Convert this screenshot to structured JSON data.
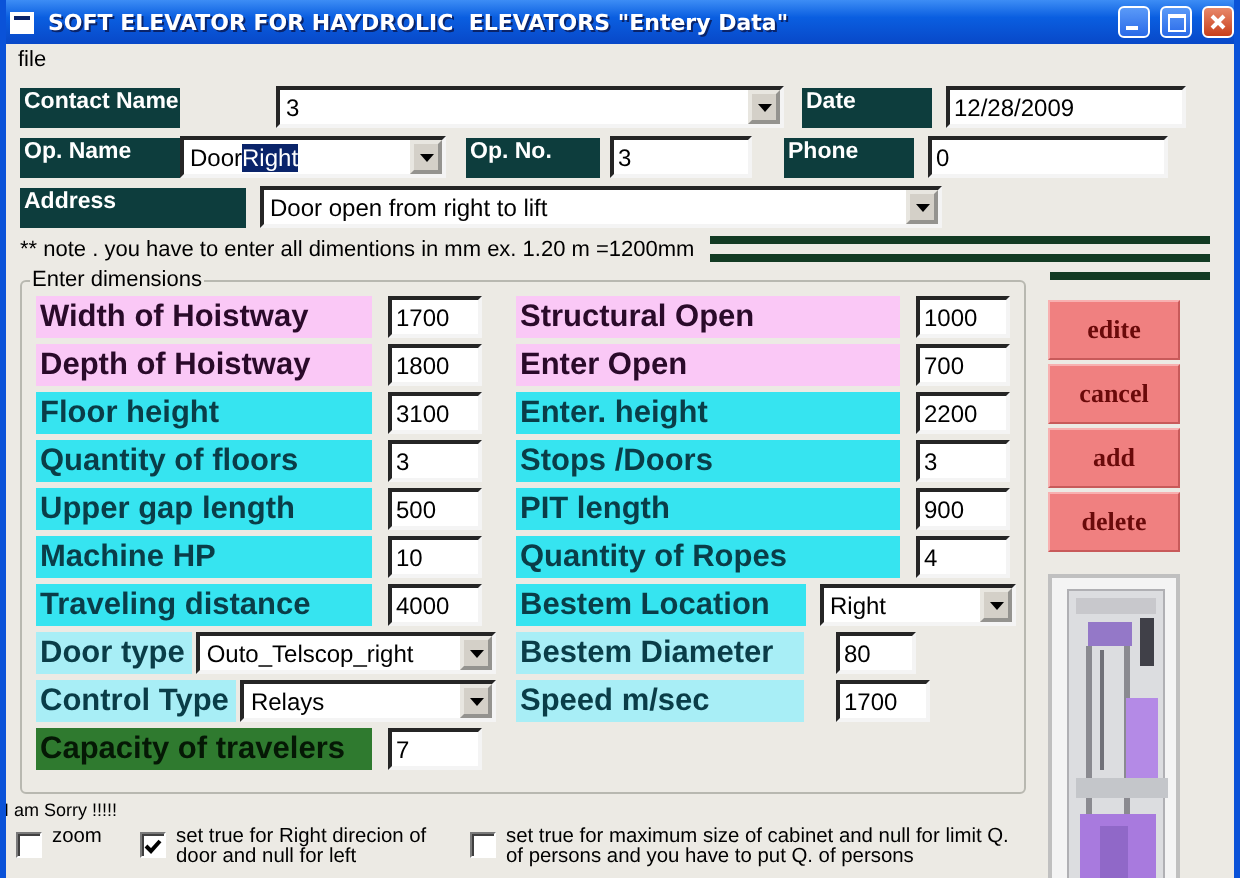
{
  "window": {
    "title": "SOFT ELEVATOR FOR HAYDROLIC  ELEVATORS \"Entery Data\""
  },
  "menu": [
    {
      "label": "file"
    }
  ],
  "header": {
    "contact_name": {
      "label": "Contact Name",
      "value": "3"
    },
    "date": {
      "label": "Date",
      "value": "12/28/2009"
    },
    "op_name": {
      "label": "Op. Name",
      "value": "Door",
      "highlighted": "Right"
    },
    "op_no": {
      "label": "Op. No.",
      "value": "3"
    },
    "phone": {
      "label": "Phone",
      "value": "0"
    },
    "address": {
      "label": "Address",
      "value": "Door open from right to lift"
    }
  },
  "note": "** note . you have to enter all dimentions in mm ex. 1.20 m =1200mm",
  "dimensions": {
    "title": "Enter dimensions",
    "rows": [
      [
        {
          "label": "Width of Hoistway",
          "color": "#fac8f6",
          "kind": "field",
          "value": "1700"
        },
        {
          "label": "Structural Open",
          "color": "#fac8f6",
          "kind": "field",
          "value": "1000"
        }
      ],
      [
        {
          "label": "Depth of Hoistway",
          "color": "#fac8f6",
          "kind": "field",
          "value": "1800"
        },
        {
          "label": "Enter Open",
          "color": "#fac8f6",
          "kind": "field",
          "value": "700"
        }
      ],
      [
        {
          "label": "Floor height",
          "color": "#36e4f0",
          "kind": "field",
          "value": "3100"
        },
        {
          "label": "Enter. height",
          "color": "#36e4f0",
          "kind": "field",
          "value": "2200"
        }
      ],
      [
        {
          "label": "Quantity of floors",
          "color": "#36e4f0",
          "kind": "field",
          "value": "3"
        },
        {
          "label": "Stops /Doors",
          "color": "#36e4f0",
          "kind": "field",
          "value": "3"
        }
      ],
      [
        {
          "label": "Upper gap length",
          "color": "#36e4f0",
          "kind": "field",
          "value": "500"
        },
        {
          "label": "PIT length",
          "color": "#36e4f0",
          "kind": "field",
          "value": "900"
        }
      ],
      [
        {
          "label": "Machine HP",
          "color": "#36e4f0",
          "kind": "field",
          "value": "10"
        },
        {
          "label": "Quantity of Ropes",
          "color": "#36e4f0",
          "kind": "field",
          "value": "4"
        }
      ],
      [
        {
          "label": "Traveling distance",
          "color": "#36e4f0",
          "kind": "field",
          "value": "4000"
        },
        {
          "label": "Bestem Location",
          "color": "#36e4f0",
          "kind": "combo",
          "value": "Right"
        }
      ],
      [
        {
          "label": "Door type",
          "color": "#a8eef6",
          "kind": "combo",
          "value": "Outo_Telscop_right"
        },
        {
          "label": "Bestem Diameter",
          "color": "#a8eef6",
          "kind": "field",
          "value": "80"
        }
      ],
      [
        {
          "label": "Control Type",
          "color": "#a8eef6",
          "kind": "combo",
          "value": "Relays"
        },
        {
          "label": "Speed m/sec",
          "color": "#a8eef6",
          "kind": "field",
          "value": "1700"
        }
      ],
      [
        {
          "label": "Capacity of travelers",
          "color": "#2f7a2f",
          "kind": "field",
          "value": "7"
        }
      ]
    ]
  },
  "buttons": [
    {
      "label": "edite"
    },
    {
      "label": "cancel"
    },
    {
      "label": "add"
    },
    {
      "label": "delete"
    }
  ],
  "status": "I am Sorry !!!!!",
  "checkboxes": [
    {
      "label": "zoom",
      "checked": false
    },
    {
      "label": "set true for Right direcion of door and null for left",
      "checked": true
    },
    {
      "label": "set true for maximum size of cabinet and null for limit Q. of persons and you have to put Q. of persons",
      "checked": false
    }
  ]
}
